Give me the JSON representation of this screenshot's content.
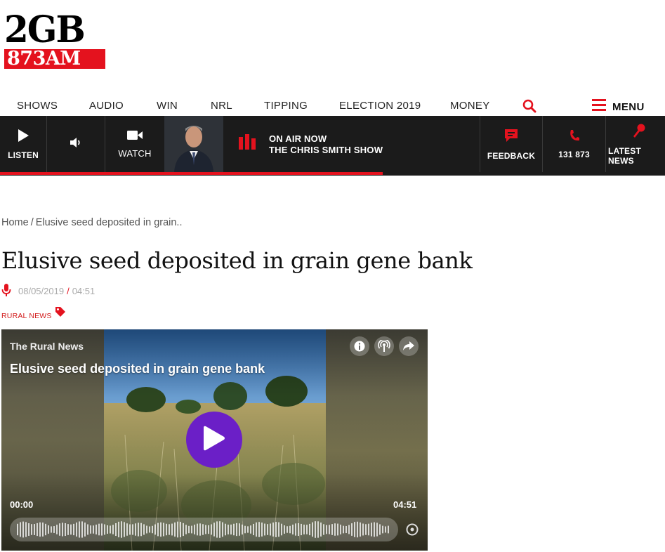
{
  "brand": {
    "logo_top": "2GB",
    "logo_bottom": "873AM",
    "red": "#e4121e"
  },
  "topnav": {
    "items": [
      "SHOWS",
      "AUDIO",
      "WIN",
      "NRL",
      "TIPPING",
      "ELECTION 2019",
      "MONEY"
    ],
    "search_icon": "search-icon",
    "menu_label": "MENU"
  },
  "onair_bar": {
    "listen_label": "LISTEN",
    "watch_label": "WATCH",
    "onair_line1": "ON AIR NOW",
    "onair_line2": "THE CHRIS SMITH SHOW",
    "feedback_label": "FEEDBACK",
    "phone_label": "131 873",
    "latest_news_label": "LATEST NEWS",
    "progress_fraction": 0.576
  },
  "breadcrumb": {
    "home": "Home",
    "separator": "/",
    "current": "Elusive seed deposited in grain.."
  },
  "article": {
    "title": "Elusive seed deposited in grain gene bank",
    "date": "08/05/2019",
    "meta_separator": "/",
    "time": "04:51",
    "tag": "RURAL NEWS"
  },
  "player": {
    "show_name": "The Rural News",
    "episode_title": "Elusive seed deposited in grain gene bank",
    "current_time": "00:00",
    "duration": "04:51",
    "play_color": "#6b1fc7",
    "icons": [
      "info-icon",
      "podcast-icon",
      "share-icon",
      "play-icon",
      "playback-speed-icon"
    ]
  }
}
